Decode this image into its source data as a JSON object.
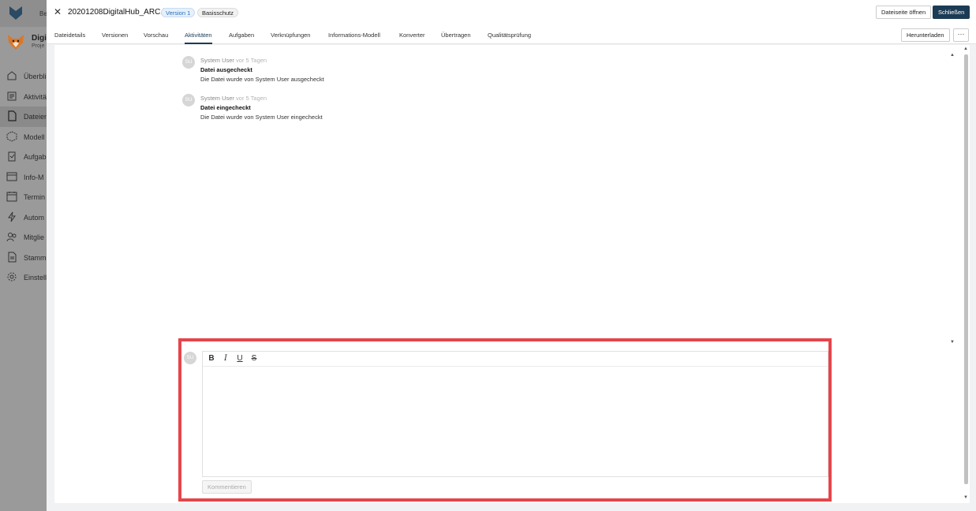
{
  "background": {
    "topbar_text": "Be",
    "project": {
      "name": "Digi",
      "sub": "Proje"
    },
    "nav": [
      {
        "label": "Überbli",
        "icon": "home-icon"
      },
      {
        "label": "Aktivitä",
        "icon": "activity-icon"
      },
      {
        "label": "Dateien",
        "icon": "file-icon",
        "active": true
      },
      {
        "label": "Modell",
        "icon": "model-icon"
      },
      {
        "label": "Aufgab",
        "icon": "task-icon"
      },
      {
        "label": "Info-M",
        "icon": "info-model-icon"
      },
      {
        "label": "Termin",
        "icon": "calendar-icon"
      },
      {
        "label": "Autom",
        "icon": "lightning-icon"
      },
      {
        "label": "Mitglie",
        "icon": "members-icon"
      },
      {
        "label": "Stamm",
        "icon": "masterdata-icon"
      },
      {
        "label": "Einstell",
        "icon": "gear-icon"
      }
    ]
  },
  "header": {
    "close": "✕",
    "file_name": "20201208DigitalHub_ARC.ifc",
    "version_tag": "Version 1",
    "protection_tag": "Basisschutz",
    "open_page_label": "Dateiseite öffnen",
    "close_label": "Schließen"
  },
  "tabs": {
    "items": [
      {
        "label": "Dateidetails"
      },
      {
        "label": "Versionen"
      },
      {
        "label": "Vorschau"
      },
      {
        "label": "Aktivitäten"
      },
      {
        "label": "Aufgaben"
      },
      {
        "label": "Verknüpfungen"
      },
      {
        "label": "Informations-Modell"
      },
      {
        "label": "Konverter"
      },
      {
        "label": "Übertragen"
      },
      {
        "label": "Qualitätsprüfung"
      }
    ],
    "active": "Aktivitäten",
    "download_label": "Herunterladen",
    "more_label": "···"
  },
  "activities": [
    {
      "initials": "SU",
      "user": "System User",
      "time": "vor 5 Tagen",
      "title": "Datei ausgecheckt",
      "desc": "Die Datei wurde von System User ausgecheckt"
    },
    {
      "initials": "SU",
      "user": "System User",
      "time": "vor 5 Tagen",
      "title": "Datei eingecheckt",
      "desc": "Die Datei wurde von System User eingecheckt"
    }
  ],
  "comment": {
    "initials": "SU",
    "toolbar": {
      "bold": "B",
      "italic": "I",
      "underline": "U",
      "strike": "S"
    },
    "submit_label": "Kommentieren"
  },
  "colors": {
    "primary": "#1c3b55",
    "highlight": "#e5454b"
  }
}
